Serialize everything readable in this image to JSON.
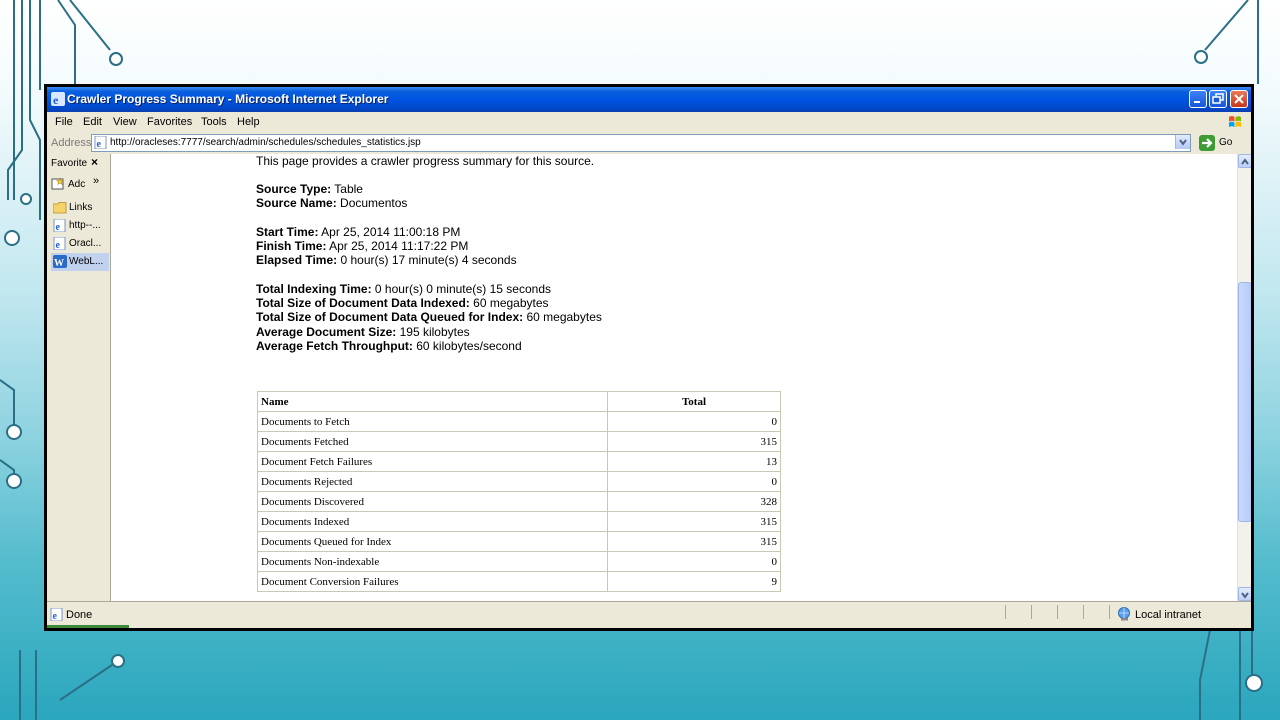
{
  "window": {
    "title": "Crawler Progress Summary - Microsoft Internet Explorer"
  },
  "menu": {
    "items": [
      "File",
      "Edit",
      "View",
      "Favorites",
      "Tools",
      "Help"
    ]
  },
  "address": {
    "label": "Address",
    "url": "http://oracleses:7777/search/admin/schedules/schedules_statistics.jsp",
    "go_label": "Go"
  },
  "favorites": {
    "title": "Favorite",
    "close": "×",
    "add_label": "Adc",
    "add_more": "»",
    "items": [
      {
        "label": "Links",
        "icon": "folder-icon"
      },
      {
        "label": "http--...",
        "icon": "ie-page-icon"
      },
      {
        "label": "Oracl...",
        "icon": "ie-page-icon"
      },
      {
        "label": "WebL...",
        "icon": "wordpress-icon"
      }
    ]
  },
  "page": {
    "intro": "This page provides a crawler progress summary for this source.",
    "source_type_label": "Source Type:",
    "source_type": "Table",
    "source_name_label": "Source Name:",
    "source_name": "Documentos",
    "start_time_label": "Start Time:",
    "start_time": "Apr 25, 2014 11:00:18 PM",
    "finish_time_label": "Finish Time:",
    "finish_time": "Apr 25, 2014 11:17:22 PM",
    "elapsed_time_label": "Elapsed Time:",
    "elapsed_time": "0 hour(s) 17 minute(s) 4 seconds",
    "indexing_time_label": "Total Indexing Time:",
    "indexing_time": "0 hour(s) 0 minute(s) 15 seconds",
    "size_indexed_label": "Total Size of Document Data Indexed:",
    "size_indexed": "60 megabytes",
    "size_queued_label": "Total Size of Document Data Queued for Index:",
    "size_queued": "60 megabytes",
    "avg_doc_size_label": "Average Document Size:",
    "avg_doc_size": "195 kilobytes",
    "avg_throughput_label": "Average Fetch Throughput:",
    "avg_throughput": "60 kilobytes/second"
  },
  "table": {
    "headers": [
      "Name",
      "Total"
    ],
    "rows": [
      [
        "Documents to Fetch",
        "0"
      ],
      [
        "Documents Fetched",
        "315"
      ],
      [
        "Document Fetch Failures",
        "13"
      ],
      [
        "Documents Rejected",
        "0"
      ],
      [
        "Documents Discovered",
        "328"
      ],
      [
        "Documents Indexed",
        "315"
      ],
      [
        "Documents Queued for Index",
        "315"
      ],
      [
        "Documents Non-indexable",
        "0"
      ],
      [
        "Document Conversion Failures",
        "9"
      ]
    ]
  },
  "status": {
    "text": "Done",
    "zone": "Local intranet"
  },
  "colors": {
    "titlebar": "#0054e3",
    "chrome": "#ece9d8"
  }
}
